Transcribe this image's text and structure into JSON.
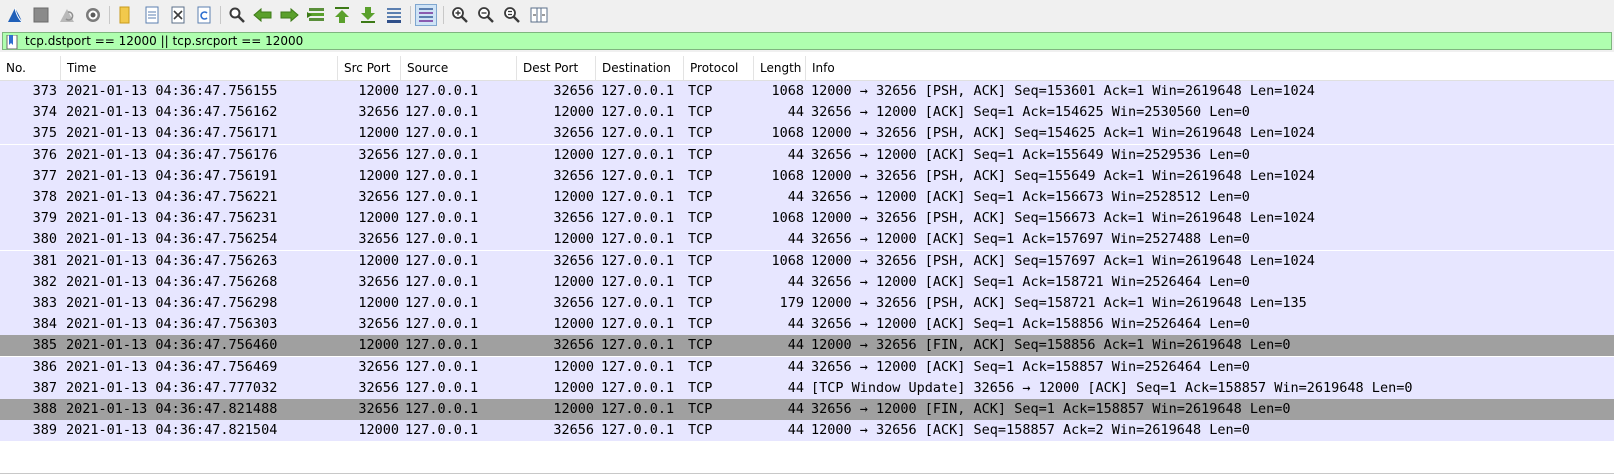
{
  "toolbar": {
    "buttons": [
      "start-capture",
      "stop-capture",
      "restart-capture",
      "capture-options",
      "open-file",
      "save-file",
      "close-file",
      "reload-file",
      "find-packet",
      "go-back",
      "go-forward",
      "go-to-packet",
      "go-first",
      "go-last",
      "auto-scroll",
      "colorize",
      "zoom-in",
      "zoom-out",
      "zoom-normal",
      "resize-columns"
    ]
  },
  "filter": {
    "value": "tcp.dstport == 12000 || tcp.srcport == 12000"
  },
  "columns": {
    "no": "No.",
    "time": "Time",
    "srcport": "Src Port",
    "source": "Source",
    "destport": "Dest Port",
    "destination": "Destination",
    "protocol": "Protocol",
    "length": "Length",
    "info": "Info"
  },
  "colors": {
    "row_bg": "#e7e6ff",
    "row_selected_bg": "#a0a0a0",
    "filter_bg": "#afffaf",
    "toolbar_bg": "#f0f0f0"
  },
  "packets": [
    {
      "no": "373",
      "time": "2021-01-13 04:36:47.756155",
      "srcport": "12000",
      "source": "127.0.0.1",
      "destport": "32656",
      "destination": "127.0.0.1",
      "protocol": "TCP",
      "length": "1068",
      "info": "12000 → 32656 [PSH, ACK] Seq=153601 Ack=1 Win=2619648 Len=1024",
      "selected": false
    },
    {
      "no": "374",
      "time": "2021-01-13 04:36:47.756162",
      "srcport": "32656",
      "source": "127.0.0.1",
      "destport": "12000",
      "destination": "127.0.0.1",
      "protocol": "TCP",
      "length": "44",
      "info": "32656 → 12000 [ACK] Seq=1 Ack=154625 Win=2530560 Len=0",
      "selected": false
    },
    {
      "no": "375",
      "time": "2021-01-13 04:36:47.756171",
      "srcport": "12000",
      "source": "127.0.0.1",
      "destport": "32656",
      "destination": "127.0.0.1",
      "protocol": "TCP",
      "length": "1068",
      "info": "12000 → 32656 [PSH, ACK] Seq=154625 Ack=1 Win=2619648 Len=1024",
      "selected": false
    },
    {
      "no": "376",
      "time": "2021-01-13 04:36:47.756176",
      "srcport": "32656",
      "source": "127.0.0.1",
      "destport": "12000",
      "destination": "127.0.0.1",
      "protocol": "TCP",
      "length": "44",
      "info": "32656 → 12000 [ACK] Seq=1 Ack=155649 Win=2529536 Len=0",
      "selected": false
    },
    {
      "no": "377",
      "time": "2021-01-13 04:36:47.756191",
      "srcport": "12000",
      "source": "127.0.0.1",
      "destport": "32656",
      "destination": "127.0.0.1",
      "protocol": "TCP",
      "length": "1068",
      "info": "12000 → 32656 [PSH, ACK] Seq=155649 Ack=1 Win=2619648 Len=1024",
      "selected": false
    },
    {
      "no": "378",
      "time": "2021-01-13 04:36:47.756221",
      "srcport": "32656",
      "source": "127.0.0.1",
      "destport": "12000",
      "destination": "127.0.0.1",
      "protocol": "TCP",
      "length": "44",
      "info": "32656 → 12000 [ACK] Seq=1 Ack=156673 Win=2528512 Len=0",
      "selected": false
    },
    {
      "no": "379",
      "time": "2021-01-13 04:36:47.756231",
      "srcport": "12000",
      "source": "127.0.0.1",
      "destport": "32656",
      "destination": "127.0.0.1",
      "protocol": "TCP",
      "length": "1068",
      "info": "12000 → 32656 [PSH, ACK] Seq=156673 Ack=1 Win=2619648 Len=1024",
      "selected": false
    },
    {
      "no": "380",
      "time": "2021-01-13 04:36:47.756254",
      "srcport": "32656",
      "source": "127.0.0.1",
      "destport": "12000",
      "destination": "127.0.0.1",
      "protocol": "TCP",
      "length": "44",
      "info": "32656 → 12000 [ACK] Seq=1 Ack=157697 Win=2527488 Len=0",
      "selected": false
    },
    {
      "no": "381",
      "time": "2021-01-13 04:36:47.756263",
      "srcport": "12000",
      "source": "127.0.0.1",
      "destport": "32656",
      "destination": "127.0.0.1",
      "protocol": "TCP",
      "length": "1068",
      "info": "12000 → 32656 [PSH, ACK] Seq=157697 Ack=1 Win=2619648 Len=1024",
      "selected": false
    },
    {
      "no": "382",
      "time": "2021-01-13 04:36:47.756268",
      "srcport": "32656",
      "source": "127.0.0.1",
      "destport": "12000",
      "destination": "127.0.0.1",
      "protocol": "TCP",
      "length": "44",
      "info": "32656 → 12000 [ACK] Seq=1 Ack=158721 Win=2526464 Len=0",
      "selected": false
    },
    {
      "no": "383",
      "time": "2021-01-13 04:36:47.756298",
      "srcport": "12000",
      "source": "127.0.0.1",
      "destport": "32656",
      "destination": "127.0.0.1",
      "protocol": "TCP",
      "length": "179",
      "info": "12000 → 32656 [PSH, ACK] Seq=158721 Ack=1 Win=2619648 Len=135",
      "selected": false
    },
    {
      "no": "384",
      "time": "2021-01-13 04:36:47.756303",
      "srcport": "32656",
      "source": "127.0.0.1",
      "destport": "12000",
      "destination": "127.0.0.1",
      "protocol": "TCP",
      "length": "44",
      "info": "32656 → 12000 [ACK] Seq=1 Ack=158856 Win=2526464 Len=0",
      "selected": false
    },
    {
      "no": "385",
      "time": "2021-01-13 04:36:47.756460",
      "srcport": "12000",
      "source": "127.0.0.1",
      "destport": "32656",
      "destination": "127.0.0.1",
      "protocol": "TCP",
      "length": "44",
      "info": "12000 → 32656 [FIN, ACK] Seq=158856 Ack=1 Win=2619648 Len=0",
      "selected": true
    },
    {
      "no": "386",
      "time": "2021-01-13 04:36:47.756469",
      "srcport": "32656",
      "source": "127.0.0.1",
      "destport": "12000",
      "destination": "127.0.0.1",
      "protocol": "TCP",
      "length": "44",
      "info": "32656 → 12000 [ACK] Seq=1 Ack=158857 Win=2526464 Len=0",
      "selected": false
    },
    {
      "no": "387",
      "time": "2021-01-13 04:36:47.777032",
      "srcport": "32656",
      "source": "127.0.0.1",
      "destport": "12000",
      "destination": "127.0.0.1",
      "protocol": "TCP",
      "length": "44",
      "info": "[TCP Window Update] 32656 → 12000 [ACK] Seq=1 Ack=158857 Win=2619648 Len=0",
      "selected": false
    },
    {
      "no": "388",
      "time": "2021-01-13 04:36:47.821488",
      "srcport": "32656",
      "source": "127.0.0.1",
      "destport": "12000",
      "destination": "127.0.0.1",
      "protocol": "TCP",
      "length": "44",
      "info": "32656 → 12000 [FIN, ACK] Seq=1 Ack=158857 Win=2619648 Len=0",
      "selected": true
    },
    {
      "no": "389",
      "time": "2021-01-13 04:36:47.821504",
      "srcport": "12000",
      "source": "127.0.0.1",
      "destport": "32656",
      "destination": "127.0.0.1",
      "protocol": "TCP",
      "length": "44",
      "info": "12000 → 32656 [ACK] Seq=158857 Ack=2 Win=2619648 Len=0",
      "selected": false
    }
  ]
}
